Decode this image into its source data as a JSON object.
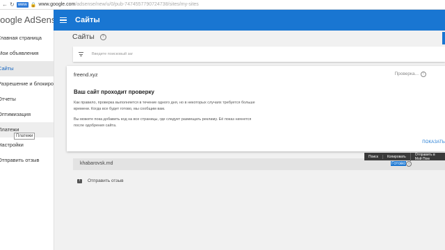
{
  "browser": {
    "badge": "www",
    "domain": "www.google.com",
    "path": "/adsense/new/u/0/pub-7474557790724738/sites/my-sites"
  },
  "sidebar": {
    "brand": "Google AdSense",
    "items": [
      {
        "label": "Главная страница"
      },
      {
        "label": "Мои объявления"
      },
      {
        "label": "Сайты"
      },
      {
        "label": "Разрешение и блокирова..."
      },
      {
        "label": "Отчеты"
      },
      {
        "label": "Оптимизация"
      },
      {
        "label": "Платежи"
      },
      {
        "label": "Настройки"
      },
      {
        "label": "Отправить отзыв"
      }
    ],
    "tooltip": "Платежи"
  },
  "appbar": {
    "title": "Сайты"
  },
  "page": {
    "title": "Сайты",
    "search_placeholder": "Введите поисковый заг"
  },
  "card": {
    "site": "freend.xyz",
    "status": "Проверка...",
    "heading": "Ваш сайт проходит проверку",
    "paragraph1": "Как правило, проверка выполняется в течение одного дня, но в некоторых случаях требуется больше времени. Когда все будет готово, мы сообщим вам.",
    "paragraph2": "Вы можете пока добавить код на все страницы, где следует размещать рекламу. Её показ начнется после одобрения сайта.",
    "show_button": "ПОКАЗАТЬ"
  },
  "row2": {
    "site": "khabarovsk.md",
    "status": "Готово"
  },
  "context_menu": [
    "Поиск",
    "Копировать",
    "Отправить в Мой Пом"
  ],
  "feedback": {
    "label": "Отправить отзыв"
  },
  "colors": {
    "primary": "#1976d2",
    "background": "#f1f1f1"
  }
}
